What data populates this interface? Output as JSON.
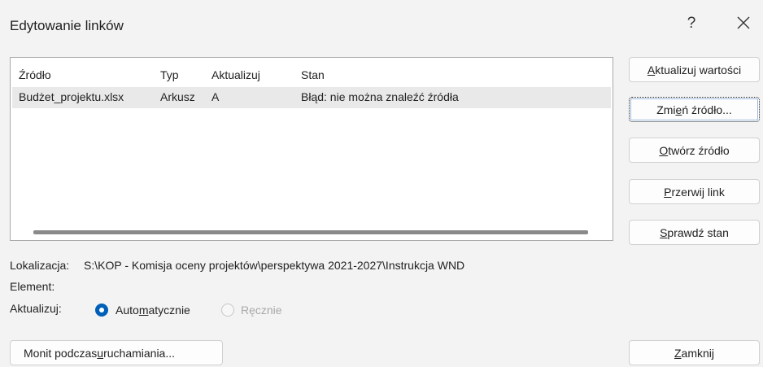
{
  "dialog": {
    "title": "Edytowanie linków",
    "help_label": "?"
  },
  "table": {
    "columns": [
      "Źródło",
      "Typ",
      "Aktualizuj",
      "Stan"
    ],
    "rows": [
      [
        "Budżet_projektu.xlsx",
        "Arkusz",
        "A",
        "Błąd: nie można znaleźć źródła"
      ]
    ]
  },
  "buttons": {
    "update_values": {
      "before": "",
      "key": "A",
      "after": "ktualizuj wartości"
    },
    "change_source": {
      "before": "Zmi",
      "key": "e",
      "after": "ń źródło..."
    },
    "open_source": {
      "before": "",
      "key": "O",
      "after": "twórz źródło"
    },
    "break_link": {
      "before": "",
      "key": "P",
      "after": "rzerwij link"
    },
    "check_status": {
      "before": "",
      "key": "S",
      "after": "prawdź stan"
    },
    "close": {
      "before": "",
      "key": "Z",
      "after": "amknij"
    },
    "startup_prompt": {
      "before": "Monit podczas ",
      "key": "u",
      "after": "ruchamiania..."
    }
  },
  "details": {
    "location_label": "Lokalizacja:",
    "location_value": "S:\\KOP - Komisja oceny projektów\\perspektywa 2021-2027\\Instrukcja WND",
    "element_label": "Element:",
    "update_label": "Aktualizuj:"
  },
  "update_mode": {
    "automatic": {
      "before": "Auto",
      "key": "m",
      "after": "atycznie",
      "selected": true
    },
    "manual": {
      "label": "Ręcznie",
      "selected": false,
      "disabled": true
    }
  },
  "colors": {
    "accent": "#005fb8",
    "selected_row": "#e9e9e9",
    "background": "#f3f3f3"
  }
}
